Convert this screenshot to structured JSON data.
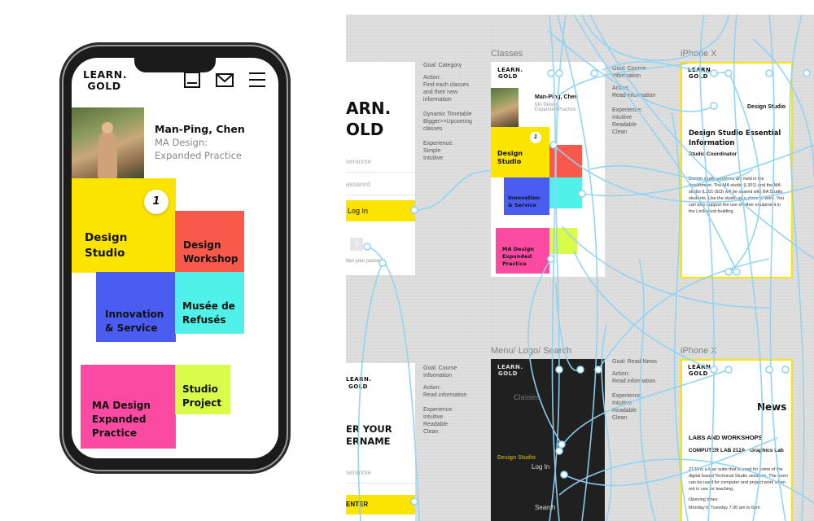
{
  "phone": {
    "logo_line1": "LEARN.",
    "logo_line2": "GOLD",
    "icons": [
      "book-icon",
      "mail-icon",
      "menu-icon"
    ],
    "profile": {
      "name": "Man-Ping, Chen",
      "program_line1": "MA Design:",
      "program_line2": "Expanded Practice"
    },
    "badge": "1",
    "tiles": {
      "design_studio": {
        "line1": "Design",
        "line2": "Studio",
        "color": "#fbe400"
      },
      "design_workshop": {
        "line1": "Design",
        "line2": "Workshop",
        "color": "#f8594a"
      },
      "innovation": {
        "line1": "Innovation",
        "line2": "& Service",
        "color": "#4b5df0"
      },
      "musee": {
        "line1": "Musée de",
        "line2": "Refusés",
        "color": "#4ff1e8"
      },
      "ma_design": {
        "line1": "MA Design",
        "line2": "Expanded",
        "line3": "Practice",
        "color": "#fb4aa2"
      },
      "studio_project": {
        "line1": "Studio",
        "line2": "Project",
        "color": "#d9fb4a"
      }
    }
  },
  "prototype": {
    "labels": {
      "classes": "Classes",
      "iphone_top": "iPhone X",
      "menu": "Menu/ Logo/ Search",
      "iphone_bottom": "iPhone X"
    },
    "login": {
      "title_line1": "ARN.",
      "title_line2": "OLD",
      "username": "seranme",
      "password": "assword",
      "button": "Log In",
      "help": "?",
      "forgot": "tten your passwor"
    },
    "ann_login": {
      "goal": "Goal: Category",
      "action": "Action:",
      "action_items": [
        "Find each classes",
        "and their new",
        "information",
        "",
        "Dynamic Timetable",
        "Bigger>>Upcoming",
        "classes"
      ],
      "experience": "Experience:",
      "exp_items": [
        "Simple",
        "Intuitive"
      ]
    },
    "classes": {
      "logo1": "LEARN.",
      "logo2": "GOLD",
      "name": "Man-Ping, Chen",
      "program": "MA Design: Expanded Practice",
      "badge": "1",
      "tile_ds": "Design Studio",
      "tile_inno": "Innovation & Service",
      "tile_ma": "MA Design Expanded Practice",
      "tile_sp": "Studio Project"
    },
    "ann_classes": {
      "goal": "Goal: Course",
      "goal2": "Information",
      "action": "Action:",
      "action_items": [
        "Read information"
      ],
      "experience": "Experience:",
      "exp_items": [
        "Intuitive",
        "Readable",
        "Clean"
      ]
    },
    "studio_info": {
      "logo1": "LEARN.",
      "logo2": "GOLD",
      "tag": "Design Studio",
      "title": "Design Studio Essential Information",
      "subtitle": "Studio Coordinator",
      "body": "Design studio sessions are held in the department. The MA studio (L301) and the MA studio (L301-303) will be shared with BA Studio students. Use the studio as a place to work. You can also support the use of other equipment in the Lockwood building."
    },
    "enter": {
      "logo1": "LEARN.",
      "logo2": "GOLD",
      "title_line1": "ER YOUR",
      "title_line2": "ERNAME",
      "username": "seranme",
      "button": "ENTER"
    },
    "ann_enter": {
      "goal": "Goal: Course",
      "goal2": "Information",
      "action": "Action:",
      "action_items": [
        "Read information"
      ],
      "experience": "Experience:",
      "exp_items": [
        "Intuitive",
        "Readable",
        "Clean"
      ]
    },
    "menu": {
      "logo1": "LEARN.",
      "logo2": "GOLD",
      "classes": "Classes",
      "item": "Design Studio",
      "login": "Log In",
      "search": "Search"
    },
    "ann_menu": {
      "goal": "Goal: Read News",
      "action": "Action:",
      "action_items": [
        "Read information"
      ],
      "experience": "Experience:",
      "exp_items": [
        "Intuitive",
        "Readable",
        "Clean"
      ]
    },
    "news": {
      "logo1": "LEARN.",
      "logo2": "GOLD",
      "title": "News",
      "section": "LABS AND WORKSHOPS",
      "lab": "COMPUTER LAB 212A - Graphics Lab",
      "body": "212A is a Mac suite that is used for some of the digital based Technical Studio sessions. The room can be used for computer and project work when not in use for teaching.",
      "opening": "Opening times:",
      "hours": "Monday to Tuesday 7.00 am to 6pm"
    },
    "wire_color": "#8fd3f4",
    "highlight_color": "#fbe400"
  }
}
